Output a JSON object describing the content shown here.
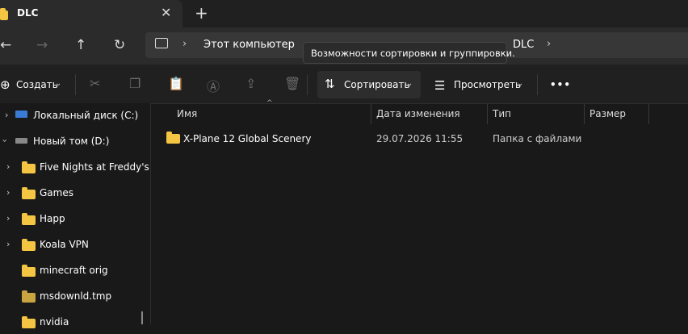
{
  "tab": {
    "title": "DLC",
    "close_icon": "close-icon",
    "new_tab_icon": "plus-icon"
  },
  "nav": {
    "back_icon": "arrow-left-icon",
    "forward_icon": "arrow-right-icon",
    "up_icon": "arrow-up-icon",
    "refresh_icon": "refresh-icon",
    "breadcrumbs": [
      "Этот компьютер",
      "DLC"
    ]
  },
  "tooltip": {
    "text": "Возможности сортировки и группировки."
  },
  "toolbar": {
    "create_label": "Создать",
    "sort_label": "Сортировать",
    "view_label": "Просмотреть",
    "more_label": "•••"
  },
  "sidebar": {
    "items": [
      {
        "label": "Локальный диск (C:)",
        "icon": "drive-icon"
      },
      {
        "label": "Новый том (D:)",
        "icon": "drive-icon"
      },
      {
        "label": "Five Nights at Freddy's",
        "icon": "folder-icon"
      },
      {
        "label": "Games",
        "icon": "folder-icon"
      },
      {
        "label": "Happ",
        "icon": "folder-icon"
      },
      {
        "label": "Koala VPN",
        "icon": "folder-icon"
      },
      {
        "label": "minecraft orig",
        "icon": "folder-icon"
      },
      {
        "label": "msdownld.tmp",
        "icon": "folder-icon"
      },
      {
        "label": "nvidia",
        "icon": "folder-icon"
      }
    ]
  },
  "columns": {
    "name": "Имя",
    "date": "Дата изменения",
    "type": "Тип",
    "size": "Размер"
  },
  "files": [
    {
      "name": "X-Plane 12 Global Scenery",
      "date": "29.07.2026 11:55",
      "type": "Папка с файлами",
      "size": ""
    }
  ]
}
